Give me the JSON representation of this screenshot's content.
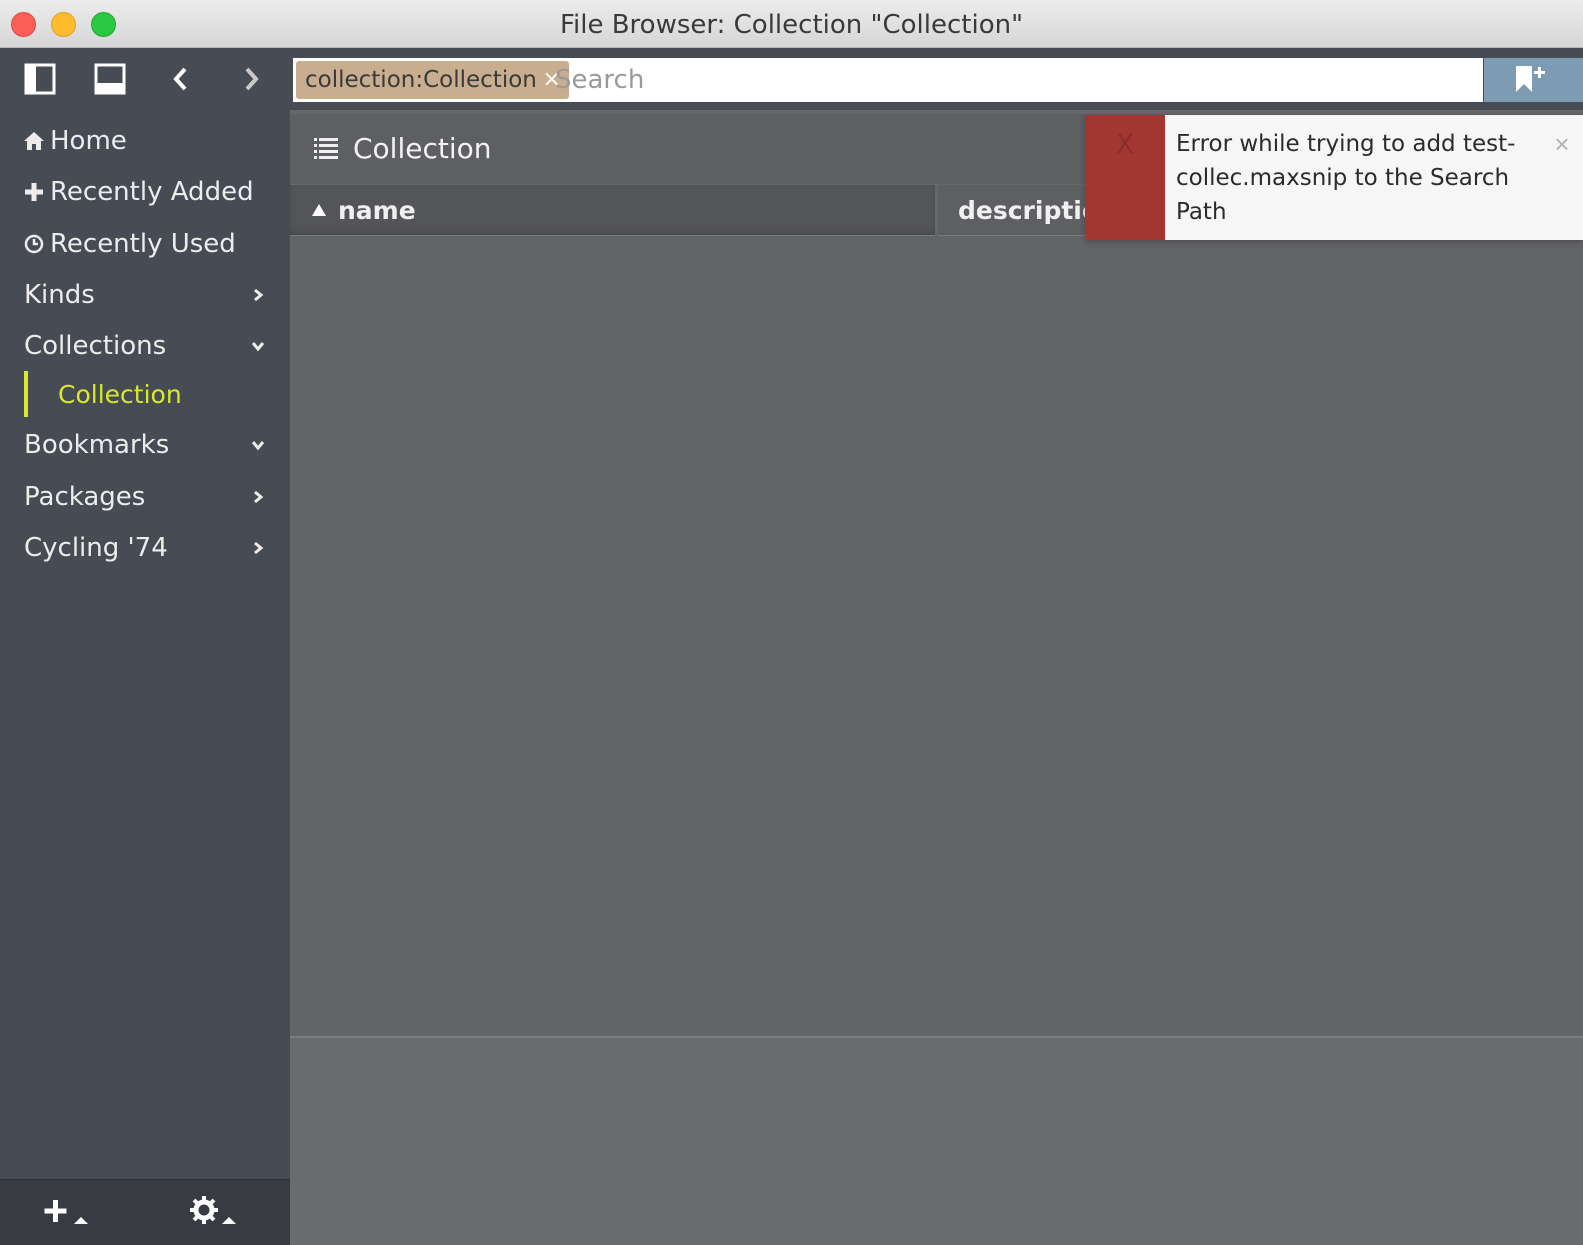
{
  "window": {
    "title": "File Browser: Collection \"Collection\""
  },
  "toolbar": {
    "icons": [
      "sidebar-toggle-icon",
      "bottom-panel-icon",
      "back-icon",
      "forward-icon"
    ]
  },
  "sidebar": {
    "items": [
      {
        "label": "Home",
        "icon": "home-icon"
      },
      {
        "label": "Recently Added",
        "icon": "plus-icon"
      },
      {
        "label": "Recently Used",
        "icon": "clock-icon"
      },
      {
        "label": "Kinds",
        "chevron": "right"
      },
      {
        "label": "Collections",
        "chevron": "down"
      },
      {
        "label": "Bookmarks",
        "chevron": "down"
      },
      {
        "label": "Packages",
        "chevron": "right"
      },
      {
        "label": "Cycling '74",
        "chevron": "right"
      }
    ],
    "collections_children": [
      {
        "label": "Collection",
        "selected": true
      }
    ],
    "footer": {
      "icons": [
        "add-menu-icon",
        "settings-menu-icon"
      ]
    }
  },
  "search": {
    "token": "collection:Collection",
    "token_remove": "×",
    "placeholder": "Search",
    "value": ""
  },
  "content": {
    "header": "Collection",
    "columns": [
      "name",
      "description"
    ],
    "sort_column": "name",
    "sort_direction": "ascending"
  },
  "notification": {
    "message": "Error while trying to add test-collec.maxsnip to the Search Path",
    "badge": "X",
    "close": "×"
  },
  "colors": {
    "selected_accent": "#d6e92a",
    "error_badge": "#a43632",
    "token_bg": "#c8ad8e",
    "bookmark_button": "#7d9bb2"
  }
}
